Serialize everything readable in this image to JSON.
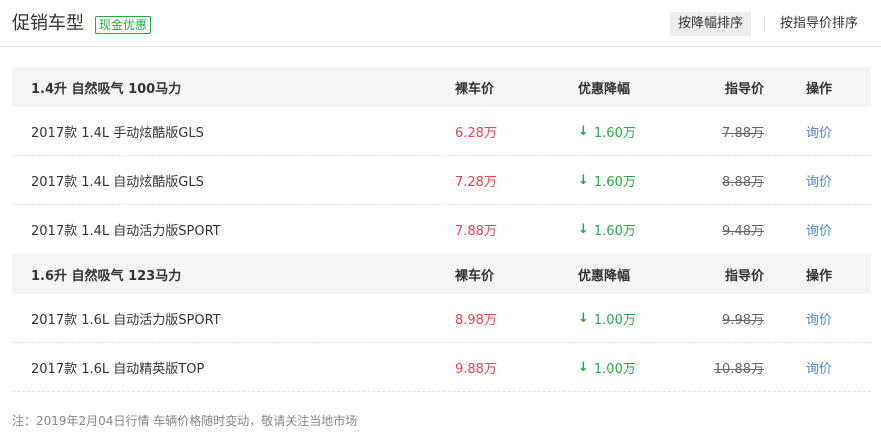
{
  "header": {
    "title": "促销车型",
    "badge": "现金优惠",
    "sort_by_discount": "按降幅排序",
    "sort_by_guide": "按指导价排序"
  },
  "groups": [
    {
      "name": "1.4升 自然吸气 100马力",
      "columns": {
        "price": "裸车价",
        "discount": "优惠降幅",
        "guide": "指导价",
        "op": "操作"
      },
      "rows": [
        {
          "name": "2017款 1.4L 手动炫酷版GLS",
          "price": "6.28万",
          "discount": "1.60万",
          "guide": "7.88万",
          "op": "询价"
        },
        {
          "name": "2017款 1.4L 自动炫酷版GLS",
          "price": "7.28万",
          "discount": "1.60万",
          "guide": "8.88万",
          "op": "询价"
        },
        {
          "name": "2017款 1.4L 自动活力版SPORT",
          "price": "7.88万",
          "discount": "1.60万",
          "guide": "9.48万",
          "op": "询价"
        }
      ]
    },
    {
      "name": "1.6升 自然吸气 123马力",
      "columns": {
        "price": "裸车价",
        "discount": "优惠降幅",
        "guide": "指导价",
        "op": "操作"
      },
      "rows": [
        {
          "name": "2017款 1.6L 自动活力版SPORT",
          "price": "8.98万",
          "discount": "1.00万",
          "guide": "9.98万",
          "op": "询价"
        },
        {
          "name": "2017款 1.6L 自动精英版TOP",
          "price": "9.88万",
          "discount": "1.00万",
          "guide": "10.88万",
          "op": "询价"
        }
      ]
    }
  ],
  "icons": {
    "discount_arrow": "down-arrow-icon",
    "arrow_glyph": "↓"
  },
  "colors": {
    "price": "#e8454f",
    "discount": "#2aa84a",
    "link": "#4a86c8",
    "badge": "#2aa84a"
  },
  "footer": {
    "note": "注：2019年2月04日行情 车辆价格随时变动，敬请关注当地市场"
  }
}
